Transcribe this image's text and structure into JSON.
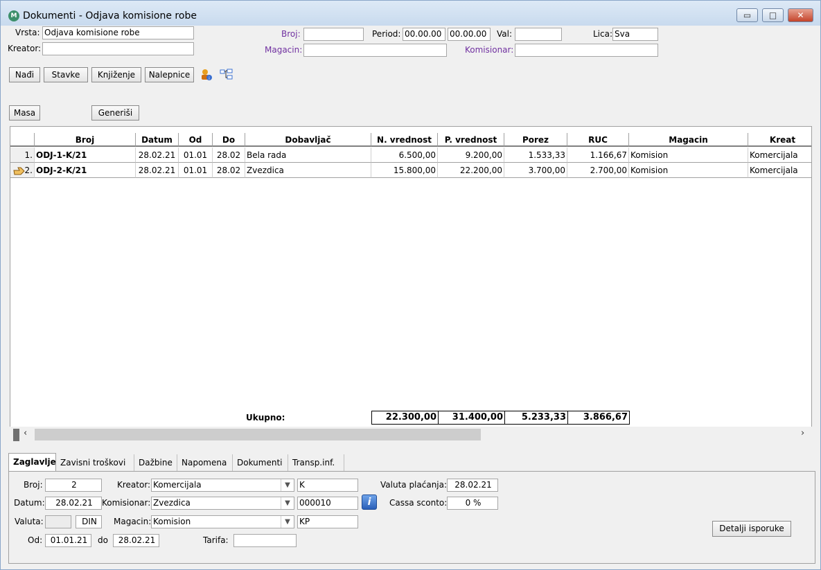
{
  "window": {
    "title": "Dokumenti - Odjava komisione robe",
    "minimize": "▭",
    "maximize": "□",
    "close": "✕"
  },
  "filters": {
    "vrsta_label": "Vrsta:",
    "vrsta_value": "Odjava komisione robe",
    "kreator_label": "Kreator:",
    "kreator_value": "",
    "broj_label": "Broj:",
    "broj_value": "",
    "period_label": "Period:",
    "period_from": "00.00.00",
    "period_to": "00.00.00",
    "val_label": "Val:",
    "val_value": "",
    "lica_label": "Lica:",
    "lica_value": "Sva",
    "magacin_label": "Magacin:",
    "magacin_value": "",
    "komisionar_label": "Komisionar:",
    "komisionar_value": ""
  },
  "toolbar": {
    "nadji": "Nađi",
    "stavke": "Stavke",
    "knjizenje": "Knjiženje",
    "nalepnice": "Nalepnice",
    "masa": "Masa",
    "generisi": "Generiši"
  },
  "grid": {
    "columns": [
      "Broj",
      "Datum",
      "Od",
      "Do",
      "Dobavljač",
      "N. vrednost",
      "P. vrednost",
      "Porez",
      "RUC",
      "Magacin",
      "Kreat"
    ],
    "rows": [
      {
        "num": "1.",
        "broj": "ODJ-1-K/21",
        "datum": "28.02.21",
        "od": "01.01",
        "do": "28.02",
        "dobavljac": "Bela rada",
        "nvr": "6.500,00",
        "pvr": "9.200,00",
        "porez": "1.533,33",
        "ruc": "1.166,67",
        "magacin": "Komision",
        "kreator": "Komercijala"
      },
      {
        "num": "2.",
        "broj": "ODJ-2-K/21",
        "datum": "28.02.21",
        "od": "01.01",
        "do": "28.02",
        "dobavljac": "Zvezdica",
        "nvr": "15.800,00",
        "pvr": "22.200,00",
        "porez": "3.700,00",
        "ruc": "2.700,00",
        "magacin": "Komision",
        "kreator": "Komercijala"
      }
    ],
    "total_label": "Ukupno:",
    "totals": {
      "nvr": "22.300,00",
      "pvr": "31.400,00",
      "porez": "5.233,33",
      "ruc": "3.866,67"
    }
  },
  "tabs": [
    "Zaglavlje",
    "Zavisni troškovi",
    "Dažbine",
    "Napomena",
    "Dokumenti",
    "Transp.inf."
  ],
  "detail": {
    "broj_label": "Broj:",
    "broj": "2",
    "datum_label": "Datum:",
    "datum": "28.02.21",
    "valuta_label": "Valuta:",
    "valuta": "",
    "valuta_code": "DIN",
    "od_label": "Od:",
    "od": "01.01.21",
    "do_label": "do",
    "do": "28.02.21",
    "kreator_label": "Kreator:",
    "kreator": "Komercijala",
    "kreator_code": "K",
    "komisionar_label": "Komisionar:",
    "komisionar": "Zvezdica",
    "komisionar_code": "000010",
    "magacin_label": "Magacin:",
    "magacin": "Komision",
    "magacin_code": "KP",
    "tarifa_label": "Tarifa:",
    "tarifa": "",
    "valuta_placanja_label": "Valuta plaćanja:",
    "valuta_placanja": "28.02.21",
    "cassa_label": "Cassa sconto:",
    "cassa": "0 %",
    "detalji_button": "Detalji isporuke"
  }
}
